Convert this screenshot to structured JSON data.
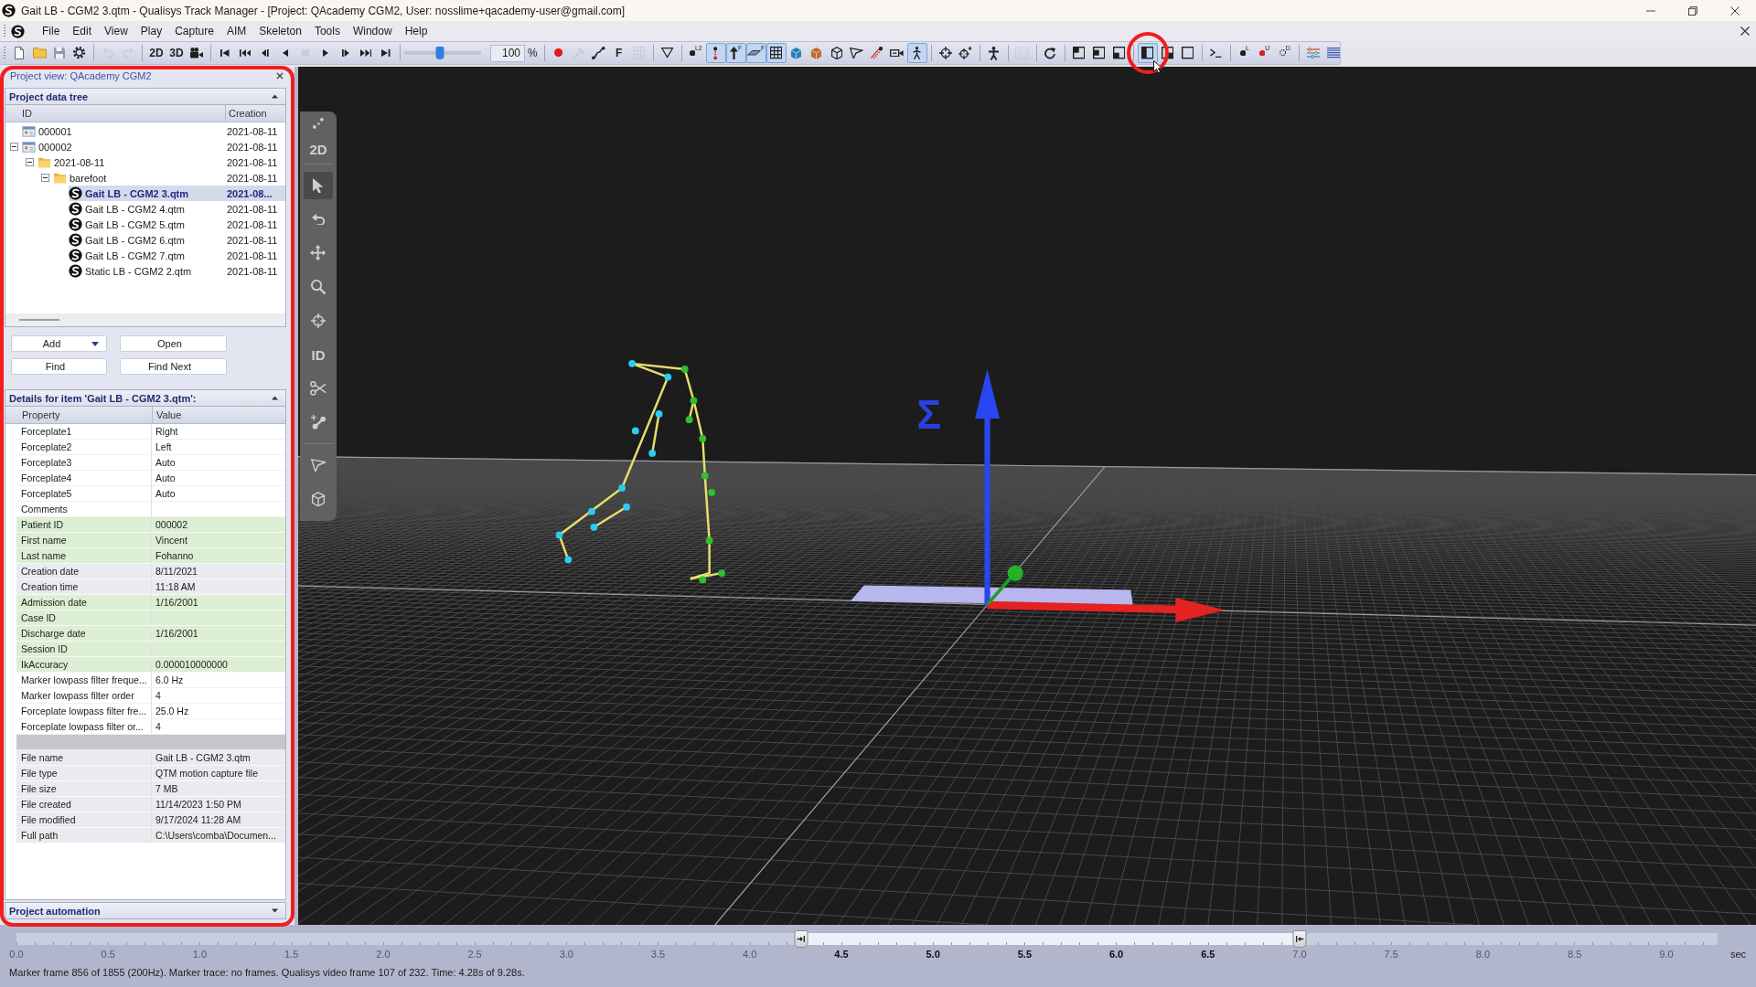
{
  "window": {
    "title": "Gait LB - CGM2 3.qtm - Qualisys Track Manager - [Project: QAcademy CGM2, User: nosslime+qacademy-user@gmail.com]"
  },
  "menu": [
    "File",
    "Edit",
    "View",
    "Play",
    "Capture",
    "AIM",
    "Skeleton",
    "Tools",
    "Window",
    "Help"
  ],
  "toolbar": {
    "groups": [
      {
        "items": [
          {
            "kind": "new",
            "selected": false,
            "disabled": false,
            "highlighted": false
          },
          {
            "kind": "open",
            "selected": false,
            "disabled": false,
            "highlighted": false
          },
          {
            "kind": "save",
            "selected": false,
            "disabled": false,
            "highlighted": false
          },
          {
            "kind": "settings",
            "selected": false,
            "disabled": false,
            "highlighted": false
          }
        ]
      },
      {
        "items": [
          {
            "kind": "undo",
            "selected": false,
            "disabled": true,
            "highlighted": false
          },
          {
            "kind": "redo",
            "selected": false,
            "disabled": true,
            "highlighted": false
          }
        ]
      },
      {
        "items": [
          {
            "kind": "text",
            "label": "2D",
            "selected": false,
            "disabled": false,
            "highlighted": false
          },
          {
            "kind": "text",
            "label": "3D",
            "selected": false,
            "disabled": false,
            "highlighted": false
          },
          {
            "kind": "video",
            "selected": false,
            "disabled": false,
            "highlighted": false
          }
        ]
      },
      {
        "items": [
          {
            "kind": "first",
            "selected": false,
            "disabled": false,
            "highlighted": false
          },
          {
            "kind": "rewind",
            "selected": false,
            "disabled": false,
            "highlighted": false
          },
          {
            "kind": "stepback",
            "selected": false,
            "disabled": false,
            "highlighted": false
          },
          {
            "kind": "back",
            "selected": false,
            "disabled": false,
            "highlighted": false
          },
          {
            "kind": "stop",
            "selected": false,
            "disabled": true,
            "highlighted": false
          },
          {
            "kind": "play",
            "selected": false,
            "disabled": false,
            "highlighted": false
          },
          {
            "kind": "stepfwd",
            "selected": false,
            "disabled": false,
            "highlighted": false
          },
          {
            "kind": "ffwd",
            "selected": false,
            "disabled": false,
            "highlighted": false
          },
          {
            "kind": "last",
            "selected": false,
            "disabled": false,
            "highlighted": false
          }
        ]
      },
      {
        "items": [
          {
            "kind": "slider",
            "level": 0.47
          },
          {
            "kind": "field",
            "value": "100"
          },
          {
            "kind": "unit",
            "label": "%"
          }
        ]
      },
      {
        "items": [
          {
            "kind": "record",
            "selected": false,
            "disabled": false,
            "highlighted": false
          },
          {
            "kind": "hammer",
            "selected": false,
            "disabled": true,
            "highlighted": false
          },
          {
            "kind": "curve",
            "selected": false,
            "disabled": false,
            "highlighted": false
          },
          {
            "kind": "text",
            "label": "F",
            "selected": false,
            "disabled": false,
            "highlighted": false
          },
          {
            "kind": "grid",
            "selected": false,
            "disabled": true,
            "highlighted": false
          }
        ]
      },
      {
        "items": [
          {
            "kind": "triangle",
            "selected": false,
            "disabled": false,
            "highlighted": false
          }
        ]
      },
      {
        "items": [
          {
            "kind": "labeled",
            "label": "L2",
            "selected": false,
            "disabled": false,
            "highlighted": false
          },
          {
            "kind": "pair",
            "selected": true,
            "disabled": false,
            "highlighted": false
          },
          {
            "kind": "force",
            "label": "F",
            "selected": true,
            "disabled": false,
            "highlighted": false
          },
          {
            "kind": "plate",
            "label": "F",
            "selected": true,
            "disabled": false,
            "highlighted": false
          },
          {
            "kind": "grid",
            "selected": true,
            "disabled": false,
            "highlighted": false
          },
          {
            "kind": "cube",
            "selected": false,
            "disabled": false,
            "highlighted": false
          },
          {
            "kind": "box",
            "selected": false,
            "disabled": false,
            "highlighted": false
          },
          {
            "kind": "wireframe",
            "selected": false,
            "disabled": false,
            "highlighted": false
          },
          {
            "kind": "paperplane",
            "selected": false,
            "disabled": false,
            "highlighted": false
          },
          {
            "kind": "trail",
            "selected": false,
            "disabled": false,
            "highlighted": false
          },
          {
            "kind": "camera",
            "selected": false,
            "disabled": false,
            "highlighted": false
          },
          {
            "kind": "skeleton",
            "selected": true,
            "disabled": false,
            "highlighted": false
          }
        ]
      },
      {
        "items": [
          {
            "kind": "crosshair",
            "selected": false,
            "disabled": false,
            "highlighted": false
          },
          {
            "kind": "crossplus",
            "selected": false,
            "disabled": false,
            "highlighted": false
          }
        ]
      },
      {
        "items": [
          {
            "kind": "person",
            "selected": false,
            "disabled": false,
            "highlighted": false
          }
        ]
      },
      {
        "items": [
          {
            "kind": "wave",
            "selected": false,
            "disabled": true,
            "highlighted": false
          }
        ]
      },
      {
        "items": [
          {
            "kind": "refresh",
            "selected": false,
            "disabled": false,
            "highlighted": false
          }
        ]
      },
      {
        "items": [
          {
            "kind": "lay1",
            "selected": false,
            "disabled": false,
            "highlighted": false
          },
          {
            "kind": "lay2",
            "selected": false,
            "disabled": false,
            "highlighted": false
          },
          {
            "kind": "lay3",
            "selected": false,
            "disabled": false,
            "highlighted": false
          }
        ]
      },
      {
        "items": [
          {
            "kind": "lay4",
            "selected": true,
            "disabled": false,
            "highlighted": true
          },
          {
            "kind": "lay5",
            "selected": false,
            "disabled": false,
            "highlighted": false
          },
          {
            "kind": "lay6",
            "selected": false,
            "disabled": false,
            "highlighted": false
          }
        ]
      },
      {
        "items": [
          {
            "kind": "terminal",
            "selected": false,
            "disabled": false,
            "highlighted": false
          }
        ]
      },
      {
        "items": [
          {
            "kind": "labeled",
            "label": "L",
            "selected": false,
            "disabled": false,
            "highlighted": false
          },
          {
            "kind": "unidentified",
            "label": "U",
            "selected": false,
            "disabled": false,
            "highlighted": false
          },
          {
            "kind": "discarded",
            "label": "D",
            "selected": false,
            "disabled": false,
            "highlighted": false
          }
        ]
      },
      {
        "items": [
          {
            "kind": "lines",
            "selected": false,
            "disabled": false,
            "highlighted": false
          },
          {
            "kind": "list",
            "selected": false,
            "disabled": false,
            "highlighted": false
          }
        ]
      }
    ]
  },
  "project_view": {
    "title": "Project view: QAcademy CGM2",
    "highlighted": true,
    "data_tree": {
      "header": {
        "label": "Project data tree",
        "expanded": true
      },
      "columns": [
        "ID",
        "Creation"
      ],
      "items": [
        {
          "id": "000001",
          "creation": "2021-08-11",
          "kind": "patient",
          "selected": false
        },
        {
          "id": "000002",
          "creation": "2021-08-11",
          "kind": "patient",
          "expanded": true,
          "selected": false,
          "children": [
            {
              "id": "2021-08-11",
              "creation": "2021-08-11",
              "kind": "folder",
              "expanded": true,
              "selected": false,
              "children": [
                {
                  "id": "barefoot",
                  "creation": "2021-08-11",
                  "kind": "folder",
                  "expanded": true,
                  "selected": false,
                  "children": [
                    {
                      "id": "Gait LB - CGM2 3.qtm",
                      "creation": "2021-08...",
                      "kind": "file",
                      "selected": true
                    },
                    {
                      "id": "Gait LB - CGM2 4.qtm",
                      "creation": "2021-08-11",
                      "kind": "file",
                      "selected": false
                    },
                    {
                      "id": "Gait LB - CGM2 5.qtm",
                      "creation": "2021-08-11",
                      "kind": "file",
                      "selected": false
                    },
                    {
                      "id": "Gait LB - CGM2 6.qtm",
                      "creation": "2021-08-11",
                      "kind": "file",
                      "selected": false
                    },
                    {
                      "id": "Gait LB - CGM2 7.qtm",
                      "creation": "2021-08-11",
                      "kind": "file",
                      "selected": false
                    },
                    {
                      "id": "Static LB - CGM2 2.qtm",
                      "creation": "2021-08-11",
                      "kind": "file",
                      "selected": false
                    }
                  ]
                }
              ]
            }
          ]
        }
      ]
    },
    "buttons": [
      {
        "label": "Add",
        "kind": "dropdown"
      },
      {
        "label": "Open",
        "kind": "plain"
      },
      {
        "label": "Find",
        "kind": "plain"
      },
      {
        "label": "Find Next",
        "kind": "plain"
      }
    ],
    "details": {
      "header": {
        "label": "Details for item 'Gait LB - CGM2 3.qtm':",
        "expanded": true
      },
      "columns": [
        "Property",
        "Value"
      ],
      "rows": [
        {
          "name": "Forceplate1",
          "value": "Right",
          "kind": "plain"
        },
        {
          "name": "Forceplate2",
          "value": "Left",
          "kind": "plain"
        },
        {
          "name": "Forceplate3",
          "value": "Auto",
          "kind": "plain"
        },
        {
          "name": "Forceplate4",
          "value": "Auto",
          "kind": "plain"
        },
        {
          "name": "Forceplate5",
          "value": "Auto",
          "kind": "plain"
        },
        {
          "name": "Comments",
          "kind": "plain"
        },
        {
          "name": "Patient ID",
          "value": "000002",
          "kind": "patient"
        },
        {
          "name": "First name",
          "value": "Vincent",
          "kind": "patient"
        },
        {
          "name": "Last name",
          "value": "Fohanno",
          "kind": "patient"
        },
        {
          "name": "Creation date",
          "value": "8/11/2021",
          "kind": "info"
        },
        {
          "name": "Creation time",
          "value": "11:18 AM",
          "kind": "info"
        },
        {
          "name": "Admission date",
          "value": "1/16/2001",
          "kind": "patient"
        },
        {
          "name": "Case ID",
          "kind": "patient"
        },
        {
          "name": "Discharge date",
          "value": "1/16/2001",
          "kind": "patient"
        },
        {
          "name": "Session ID",
          "kind": "patient"
        },
        {
          "name": "IkAccuracy",
          "value": "0.000010000000",
          "kind": "patient"
        },
        {
          "name": "Marker lowpass filter freque...",
          "value": "6.0 Hz",
          "kind": "plain"
        },
        {
          "name": "Marker lowpass filter order",
          "value": "4",
          "kind": "plain"
        },
        {
          "name": "Forceplate lowpass filter fre...",
          "value": "25.0 Hz",
          "kind": "plain"
        },
        {
          "name": "Forceplate lowpass filter or...",
          "value": "4",
          "kind": "plain"
        },
        {
          "kind": "separator"
        },
        {
          "name": "File name",
          "value": "Gait LB - CGM2 3.qtm",
          "kind": "info"
        },
        {
          "name": "File type",
          "value": "QTM motion capture file",
          "kind": "info"
        },
        {
          "name": "File size",
          "value": "7 MB",
          "kind": "info"
        },
        {
          "name": "File created",
          "value": "11/14/2023 1:50 PM",
          "kind": "info"
        },
        {
          "name": "File modified",
          "value": "9/17/2024 11:28 AM",
          "kind": "info"
        },
        {
          "name": "Full path",
          "value": "C:\\Users\\comba\\Documen...",
          "kind": "info"
        }
      ]
    },
    "automation": {
      "header": {
        "label": "Project automation",
        "expanded": false
      }
    }
  },
  "viewport": {
    "toolbar": {
      "groups": [
        {
          "items": [
            {
              "kind": "points",
              "selected": false
            },
            {
              "kind": "text",
              "label": "2D",
              "selected": false
            }
          ]
        },
        {
          "items": [
            {
              "kind": "cursor",
              "selected": true
            },
            {
              "kind": "undo",
              "selected": false
            },
            {
              "kind": "move",
              "selected": false
            },
            {
              "kind": "zoom",
              "selected": false
            },
            {
              "kind": "crosshair",
              "selected": false
            },
            {
              "kind": "text",
              "label": "ID",
              "selected": false
            },
            {
              "kind": "scissors",
              "selected": false
            },
            {
              "kind": "bone",
              "selected": false
            }
          ]
        },
        {
          "items": [
            {
              "kind": "paperplane",
              "selected": false
            },
            {
              "kind": "wireframe",
              "selected": false
            }
          ]
        }
      ]
    },
    "axis_label": "Σ"
  },
  "timeline": {
    "ticks": [
      "0.0",
      "0.5",
      "1.0",
      "1.5",
      "2.0",
      "2.5",
      "3.0",
      "3.5",
      "4.0",
      "4.5",
      "5.0",
      "5.5",
      "6.0",
      "6.5",
      "7.0",
      "7.5",
      "8.0",
      "8.5",
      "9.0"
    ],
    "unit": "sec",
    "trim_start": {
      "level": 0.4612
    },
    "trim_end": {
      "level": 0.7543
    }
  },
  "status_bar": "Marker frame 856 of 1855 (200Hz). Marker trace: no frames. Qualisys video frame 107 of 232. Time: 4.28s of 9.28s."
}
